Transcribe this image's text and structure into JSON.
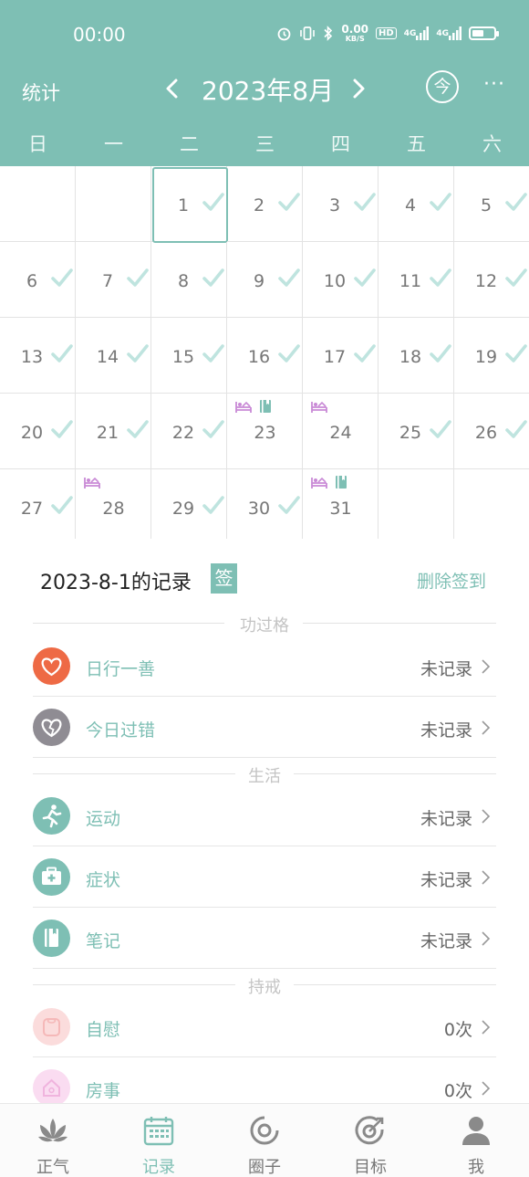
{
  "status_bar": {
    "time": "00:00",
    "net_speed": "0.00",
    "net_unit": "KB/S",
    "hd": "HD",
    "sig1": "4G",
    "sig2": "4G"
  },
  "header": {
    "stats_label": "统计",
    "month_title": "2023年8月",
    "today_label": "今",
    "more_label": "···"
  },
  "weekdays": [
    "日",
    "一",
    "二",
    "三",
    "四",
    "五",
    "六"
  ],
  "calendar": {
    "selected_day": 1,
    "days": [
      {
        "d": "1",
        "check": true,
        "col": 2,
        "row": 0
      },
      {
        "d": "2",
        "check": true,
        "col": 3,
        "row": 0
      },
      {
        "d": "3",
        "check": true,
        "col": 4,
        "row": 0
      },
      {
        "d": "4",
        "check": true,
        "col": 5,
        "row": 0
      },
      {
        "d": "5",
        "check": true,
        "col": 6,
        "row": 0
      },
      {
        "d": "6",
        "check": true,
        "col": 0,
        "row": 1
      },
      {
        "d": "7",
        "check": true,
        "col": 1,
        "row": 1
      },
      {
        "d": "8",
        "check": true,
        "col": 2,
        "row": 1
      },
      {
        "d": "9",
        "check": true,
        "col": 3,
        "row": 1
      },
      {
        "d": "10",
        "check": true,
        "col": 4,
        "row": 1
      },
      {
        "d": "11",
        "check": true,
        "col": 5,
        "row": 1
      },
      {
        "d": "12",
        "check": true,
        "col": 6,
        "row": 1
      },
      {
        "d": "13",
        "check": true,
        "col": 0,
        "row": 2
      },
      {
        "d": "14",
        "check": true,
        "col": 1,
        "row": 2
      },
      {
        "d": "15",
        "check": true,
        "col": 2,
        "row": 2
      },
      {
        "d": "16",
        "check": true,
        "col": 3,
        "row": 2
      },
      {
        "d": "17",
        "check": true,
        "col": 4,
        "row": 2
      },
      {
        "d": "18",
        "check": true,
        "col": 5,
        "row": 2
      },
      {
        "d": "19",
        "check": true,
        "col": 6,
        "row": 2
      },
      {
        "d": "20",
        "check": true,
        "col": 0,
        "row": 3
      },
      {
        "d": "21",
        "check": true,
        "col": 1,
        "row": 3
      },
      {
        "d": "22",
        "check": true,
        "col": 2,
        "row": 3
      },
      {
        "d": "23",
        "check": false,
        "col": 3,
        "row": 3,
        "marks": [
          "bed",
          "note"
        ]
      },
      {
        "d": "24",
        "check": false,
        "col": 4,
        "row": 3,
        "marks": [
          "bed"
        ]
      },
      {
        "d": "25",
        "check": true,
        "col": 5,
        "row": 3
      },
      {
        "d": "26",
        "check": true,
        "col": 6,
        "row": 3
      },
      {
        "d": "27",
        "check": true,
        "col": 0,
        "row": 4
      },
      {
        "d": "28",
        "check": false,
        "col": 1,
        "row": 4,
        "marks": [
          "bed"
        ]
      },
      {
        "d": "29",
        "check": true,
        "col": 2,
        "row": 4
      },
      {
        "d": "30",
        "check": true,
        "col": 3,
        "row": 4
      },
      {
        "d": "31",
        "check": false,
        "col": 4,
        "row": 4,
        "marks": [
          "bed",
          "note"
        ]
      }
    ]
  },
  "record": {
    "title": "2023-8-1的记录",
    "sign_badge": "签",
    "delete_label": "删除签到"
  },
  "sections": {
    "merit": "功过格",
    "life": "生活",
    "precept": "持戒"
  },
  "rows": [
    {
      "label": "日行一善",
      "value": "未记录",
      "icon": "heart-icon",
      "color": "#ee6a45"
    },
    {
      "label": "今日过错",
      "value": "未记录",
      "icon": "broken-heart-icon",
      "color": "#8f8c93"
    },
    {
      "label": "运动",
      "value": "未记录",
      "icon": "running-icon",
      "color": "#7ebfb4"
    },
    {
      "label": "症状",
      "value": "未记录",
      "icon": "medical-kit-icon",
      "color": "#7ebfb4"
    },
    {
      "label": "笔记",
      "value": "未记录",
      "icon": "notebook-icon",
      "color": "#7ebfb4"
    },
    {
      "label": "自慰",
      "value": "0次",
      "icon": "tissue-icon",
      "color": "#fbdcdc"
    },
    {
      "label": "房事",
      "value": "0次",
      "icon": "house-icon",
      "color": "#fadcf1"
    }
  ],
  "nav": [
    {
      "label": "正气",
      "icon": "lotus-icon",
      "active": false
    },
    {
      "label": "记录",
      "icon": "calendar-icon",
      "active": true
    },
    {
      "label": "圈子",
      "icon": "circle-icon",
      "active": false
    },
    {
      "label": "目标",
      "icon": "target-icon",
      "active": false
    },
    {
      "label": "我",
      "icon": "user-icon",
      "active": false
    }
  ],
  "colors": {
    "accent": "#7ebfb4",
    "check": "#bfe4df",
    "mark": "#c98ad6"
  }
}
